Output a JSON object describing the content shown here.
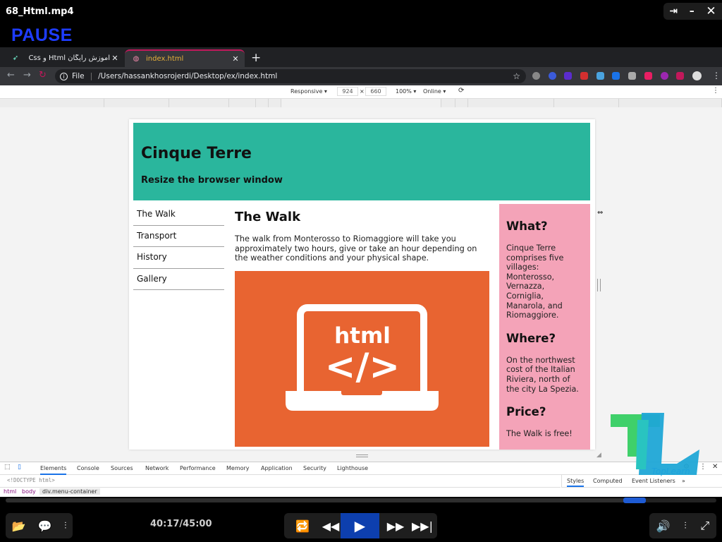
{
  "player": {
    "title": "68_Html.mp4",
    "status": "PAUSE",
    "window_controls": [
      "pin-icon",
      "minimize-icon",
      "close-icon"
    ],
    "time": "40:17/45:00",
    "progress_fraction": 0.895
  },
  "browser": {
    "tabs": [
      {
        "label": "آموزش رایگان Html و Css",
        "active": false
      },
      {
        "label": "index.html",
        "active": true
      }
    ],
    "url_scheme": "File",
    "url": "/Users/hassankhosrojerdi/Desktop/ex/index.html"
  },
  "device_toolbar": {
    "mode": "Responsive ▾",
    "width": "924",
    "times": "×",
    "height": "660",
    "zoom": "100% ▾",
    "network": "Online ▾"
  },
  "page": {
    "header_title": "Cinque Terre",
    "header_subtitle": "Resize the browser window",
    "menu": [
      "The Walk",
      "Transport",
      "History",
      "Gallery"
    ],
    "main_title": "The Walk",
    "main_text": "The walk from Monterosso to Riomaggiore will take you approximately two hours, give or take an hour depending on the weather conditions and your physical shape.",
    "image_text": "html",
    "image_code": "</>",
    "aside": [
      {
        "title": "What?",
        "text": "Cinque Terre comprises five villages: Monterosso, Vernazza, Corniglia, Manarola, and Riomaggiore."
      },
      {
        "title": "Where?",
        "text": "On the northwest cost of the Italian Riviera, north of the city La Spezia."
      },
      {
        "title": "Price?",
        "text": "The Walk is free!"
      }
    ]
  },
  "devtools": {
    "tabs": [
      "Elements",
      "Console",
      "Sources",
      "Network",
      "Performance",
      "Memory",
      "Application",
      "Security",
      "Lighthouse"
    ],
    "code_line": "<!DOCTYPE html>",
    "breadcrumbs": [
      "html",
      "body",
      "div.menu-container"
    ],
    "side_tabs": [
      "Styles",
      "Computed",
      "Event Listeners",
      "»"
    ]
  },
  "watermark": "TopLearn"
}
